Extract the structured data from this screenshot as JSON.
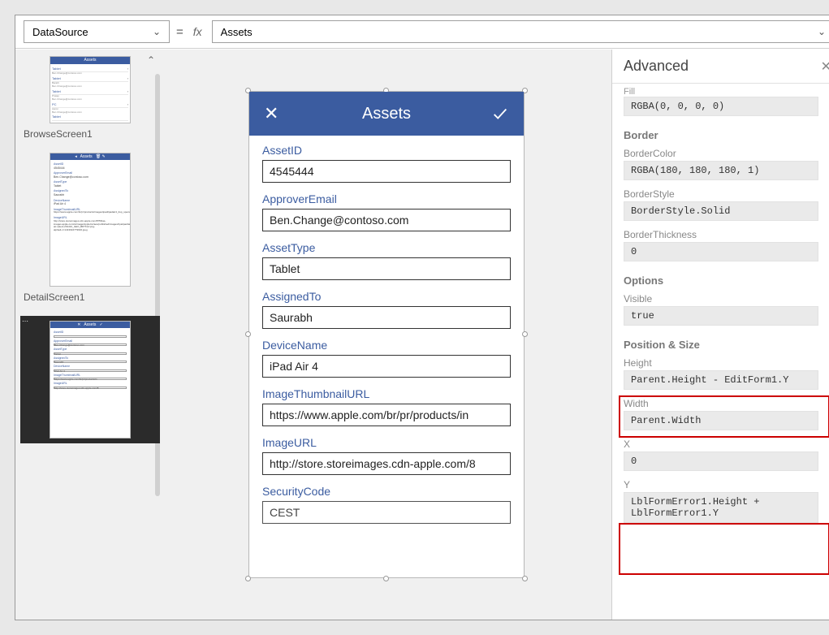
{
  "formula_bar": {
    "property": "DataSource",
    "expression": "Assets"
  },
  "tree": {
    "screen1_label": "BrowseScreen1",
    "screen2_label": "DetailScreen1",
    "thumb_header": "Assets"
  },
  "phone": {
    "title": "Assets",
    "fields": [
      {
        "label": "AssetID",
        "value": "4545444"
      },
      {
        "label": "ApproverEmail",
        "value": "Ben.Change@contoso.com"
      },
      {
        "label": "AssetType",
        "value": "Tablet"
      },
      {
        "label": "AssignedTo",
        "value": "Saurabh"
      },
      {
        "label": "DeviceName",
        "value": "iPad Air 4"
      },
      {
        "label": "ImageThumbnailURL",
        "value": "https://www.apple.com/br/pr/products/in"
      },
      {
        "label": "ImageURL",
        "value": "http://store.storeimages.cdn-apple.com/8"
      },
      {
        "label": "SecurityCode",
        "value": "CEST"
      }
    ]
  },
  "advanced": {
    "title": "Advanced",
    "fill_label_cut": "Fill",
    "fill_value": "RGBA(0, 0, 0, 0)",
    "sections": {
      "border": "Border",
      "options": "Options",
      "position": "Position & Size"
    },
    "border_color": {
      "label": "BorderColor",
      "value": "RGBA(180, 180, 180, 1)"
    },
    "border_style": {
      "label": "BorderStyle",
      "value": "BorderStyle.Solid"
    },
    "border_thickness": {
      "label": "BorderThickness",
      "value": "0"
    },
    "visible": {
      "label": "Visible",
      "value": "true"
    },
    "height": {
      "label": "Height",
      "value": "Parent.Height - EditForm1.Y"
    },
    "width": {
      "label": "Width",
      "value": "Parent.Width"
    },
    "x": {
      "label": "X",
      "value": "0"
    },
    "y": {
      "label": "Y",
      "value": "LblFormError1.Height + LblFormError1.Y"
    }
  }
}
